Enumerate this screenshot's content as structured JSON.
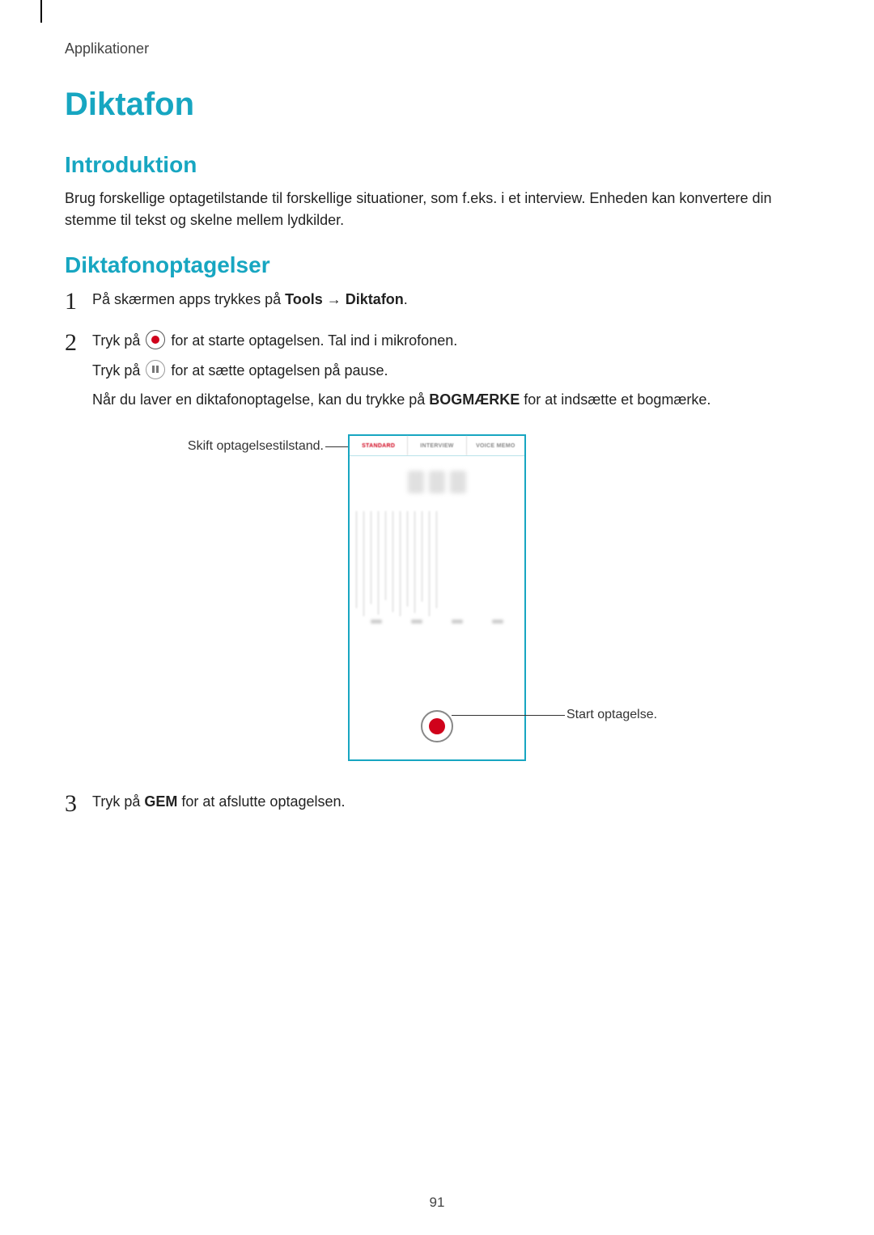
{
  "breadcrumb": "Applikationer",
  "title": "Diktafon",
  "sections": {
    "intro": {
      "heading": "Introduktion",
      "text": "Brug forskellige optagetilstande til forskellige situationer, som f.eks. i et interview. Enheden kan konvertere din stemme til tekst og skelne mellem lydkilder."
    },
    "recordings": {
      "heading": "Diktafonoptagelser",
      "steps": {
        "s1_pre": "På skærmen apps trykkes på ",
        "s1_bold1": "Tools",
        "s1_arrow": " → ",
        "s1_bold2": "Diktafon",
        "s1_post": ".",
        "s2_l1_pre": "Tryk på ",
        "s2_l1_post": " for at starte optagelsen. Tal ind i mikrofonen.",
        "s2_l2_pre": "Tryk på ",
        "s2_l2_post": " for at sætte optagelsen på pause.",
        "s2_l3_pre": "Når du laver en diktafonoptagelse, kan du trykke på ",
        "s2_l3_bold": "BOGMÆRKE",
        "s2_l3_post": " for at indsætte et bogmærke.",
        "s3_pre": "Tryk på ",
        "s3_bold": "GEM",
        "s3_post": " for at afslutte optagelsen."
      }
    }
  },
  "figure": {
    "callout_left": "Skift optagelsestilstand.",
    "callout_right": "Start optagelse.",
    "tabs": {
      "standard": "STANDARD",
      "interview": "INTERVIEW",
      "voicememo": "VOICE MEMO"
    }
  },
  "page_number": "91"
}
